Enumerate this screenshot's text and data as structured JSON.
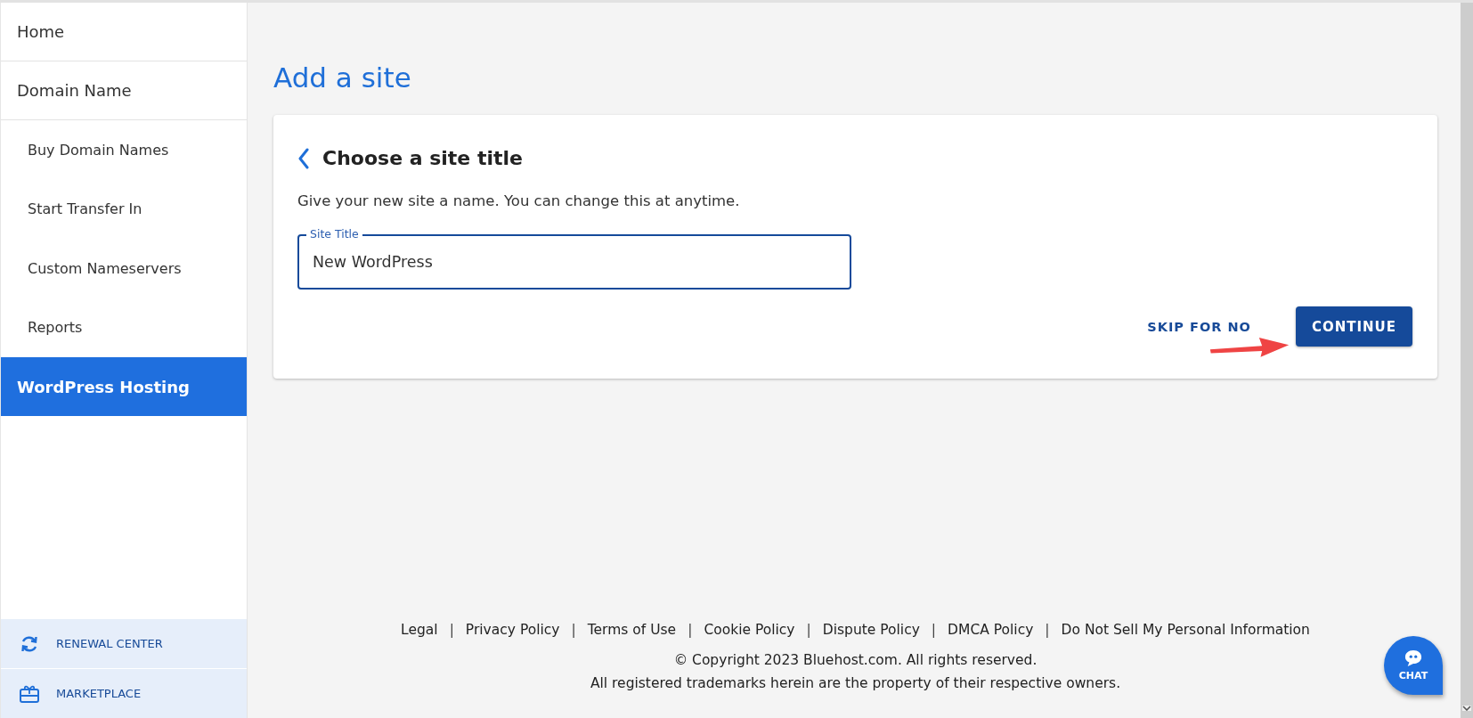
{
  "sidebar": {
    "items": [
      {
        "label": "Home",
        "selected": false
      },
      {
        "label": "Domain Name",
        "selected": false,
        "children": [
          {
            "label": "Buy Domain Names",
            "selected": false
          },
          {
            "label": "Start Transfer In",
            "selected": false
          },
          {
            "label": "Custom Nameservers",
            "selected": false
          },
          {
            "label": "Reports",
            "selected": false
          }
        ]
      },
      {
        "label": "WordPress Hosting",
        "selected": true
      }
    ],
    "bottom_links": [
      {
        "label": "RENEWAL CENTER",
        "kind": "renewal"
      },
      {
        "label": "MARKETPLACE",
        "kind": "marketplace"
      }
    ]
  },
  "page_title": "Add a site",
  "card": {
    "heading": "Choose a site title",
    "description": "Give your new site a name. You can change this at anytime.",
    "field": {
      "label": "Site Title",
      "value": "New WordPress"
    },
    "buttons": [
      {
        "label": "SKIP FOR NO",
        "kind": "text"
      },
      {
        "label": "CONTINUE",
        "kind": "primary"
      }
    ]
  },
  "footer": {
    "separator": "|",
    "links": [
      "Legal",
      "Privacy Policy",
      "Terms of Use",
      "Cookie Policy",
      "Dispute Policy",
      "DMCA Policy",
      "Do Not Sell My Personal Information"
    ],
    "copyright": "© Copyright 2023 Bluehost.com. All rights reserved.",
    "trademark": "All registered trademarks herein are the property of their respective owners."
  },
  "chat": {
    "label": "CHAT"
  }
}
